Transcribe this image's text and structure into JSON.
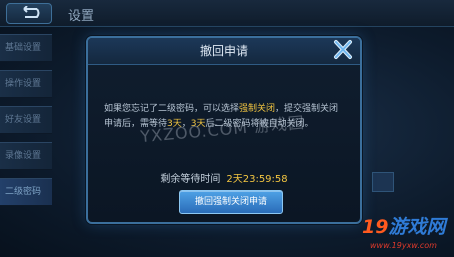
{
  "header": {
    "title": "设置"
  },
  "sidebar": {
    "items": [
      {
        "label": "基础设置"
      },
      {
        "label": "操作设置"
      },
      {
        "label": "好友设置"
      },
      {
        "label": "录像设置"
      },
      {
        "label": "二级密码"
      }
    ]
  },
  "dialog": {
    "title": "撤回申请",
    "body_part1": "如果您忘记了二级密码，可以选择",
    "body_highlight1": "强制关闭",
    "body_part2": "，提交强制关闭申请后，需等待",
    "body_highlight2": "3天",
    "body_part3": "，",
    "body_highlight3": "3天",
    "body_part4": "后二级密码将被自动关闭。",
    "timer_label": "剩余等待时间",
    "timer_value": "2天23:59:58",
    "button_label": "撤回强制关闭申请"
  },
  "watermark": {
    "center": "YXZOO.COM 游戏园",
    "logo_num": "19",
    "logo_cn": "游戏网",
    "logo_url": "www.19yxw.com"
  },
  "colors": {
    "accent_blue": "#3b6f9c",
    "highlight_yellow": "#f2c541",
    "button_blue": "#2a6cb8"
  },
  "icons": {
    "back": "back-arrow-icon",
    "close": "close-icon"
  }
}
